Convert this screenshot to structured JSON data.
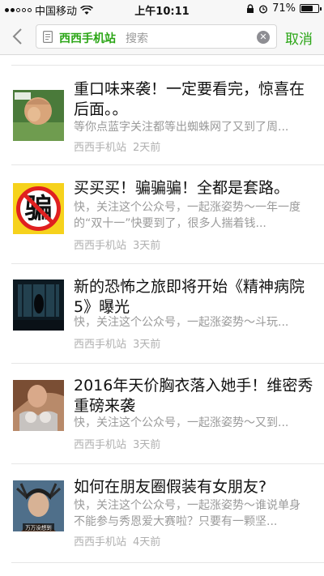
{
  "status_bar": {
    "carrier": "中国移动",
    "time": "上午10:11",
    "battery": "71%",
    "battery_level": 0.71
  },
  "search": {
    "scope_label": "西西手机站",
    "placeholder": "搜索",
    "cancel_label": "取消",
    "clear_icon": "clear-icon",
    "back_icon": "chevron-left-icon"
  },
  "articles": [
    {
      "title": "重口味来袭！一定要看完，惊喜在后面。。",
      "summary": "等你点蓝字关注都等出蜘蛛网了又到了周...",
      "source": "西西手机站",
      "time": "2天前",
      "thumb_text": ""
    },
    {
      "title": "买买买！骗骗骗！全都是套路。",
      "summary": "快，关注这个公众号，一起涨姿势～一年一度的“双十一”快要到了，很多人揣着钱...",
      "source": "西西手机站",
      "time": "3天前",
      "thumb_text": "骗"
    },
    {
      "title": "新的恐怖之旅即将开始《精神病院5》曝光",
      "summary": "快，关注这个公众号，一起涨姿势～斗玩...",
      "source": "西西手机站",
      "time": "3天前",
      "thumb_text": ""
    },
    {
      "title": "2016年天价胸衣落入她手！维密秀重磅来袭",
      "summary": "快，关注这个公众号，一起涨姿势～又到...",
      "source": "西西手机站",
      "time": "3天前",
      "thumb_text": ""
    },
    {
      "title": "如何在朋友圈假装有女朋友?",
      "summary": "快，关注这个公众号，一起涨姿势～谁说单身不能参与秀恩爱大赛啦？只要有一颗坚...",
      "source": "西西手机站",
      "time": "4天前",
      "thumb_text": "万万没想到"
    }
  ],
  "colors": {
    "accent": "#2aa515",
    "summary_text": "#9a9a9a",
    "meta_text": "#b0b0b0"
  }
}
